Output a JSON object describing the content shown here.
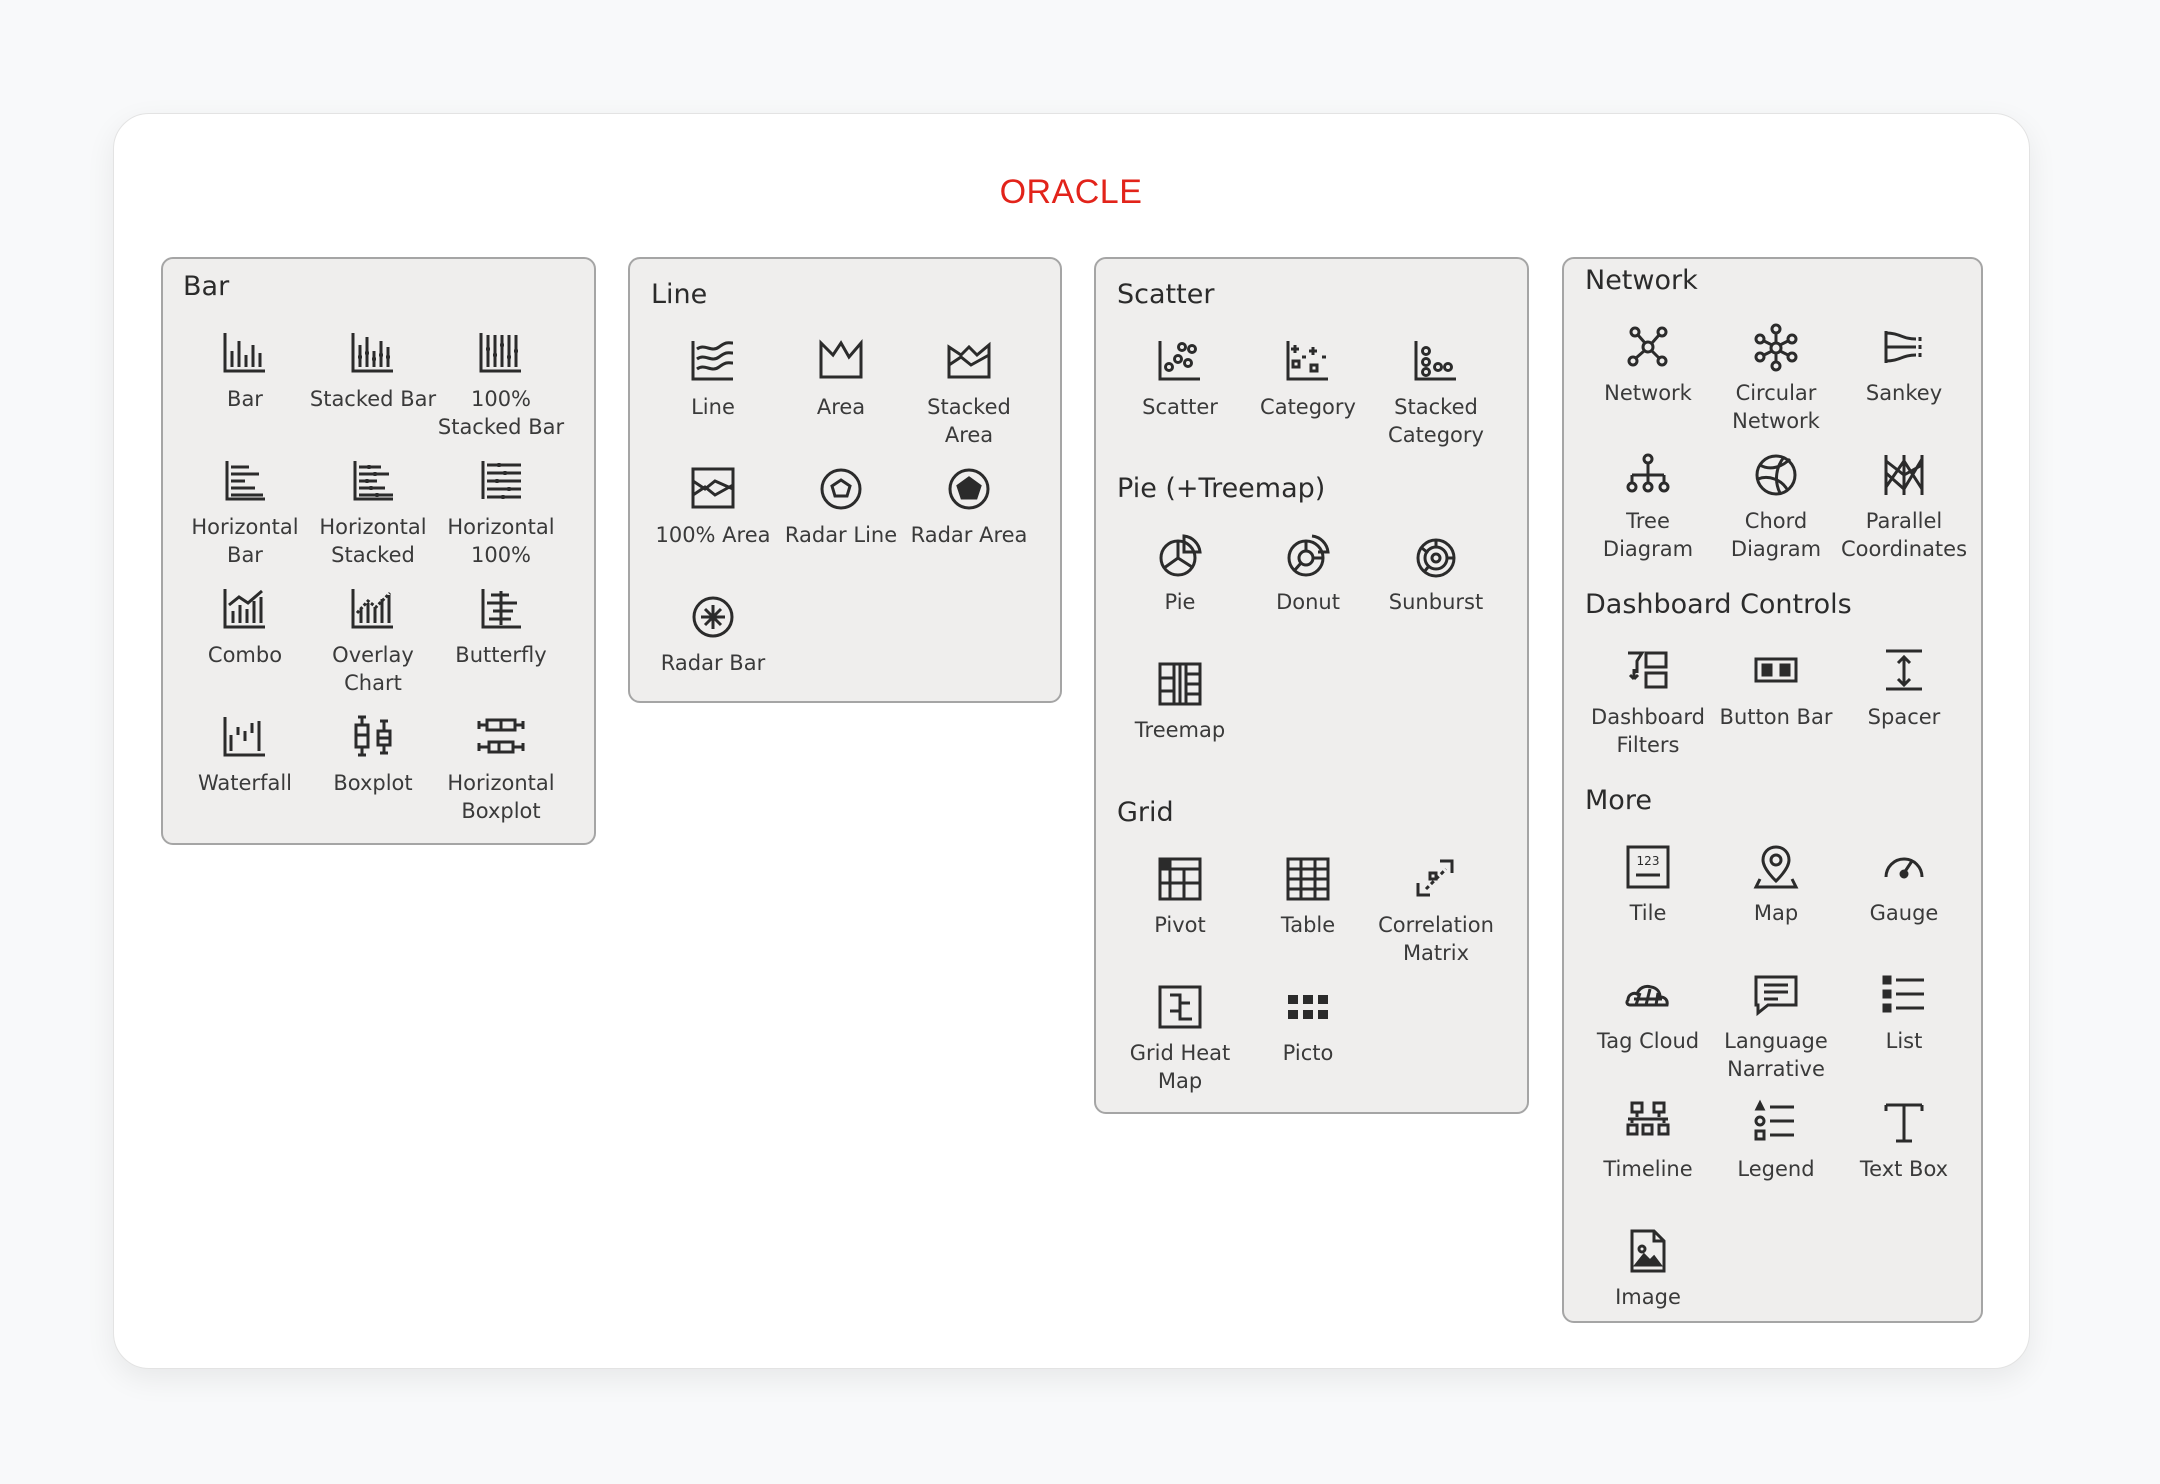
{
  "logo": {
    "text": "ORACLE",
    "color": "#e2231a"
  },
  "colors": {
    "icon": "#2b2b2b",
    "panel_bg": "#efeeed",
    "panel_border": "#a5a5a5"
  },
  "panels": {
    "bar": {
      "title": "Bar",
      "items": [
        {
          "label": "Bar",
          "icon": "bar-chart-icon"
        },
        {
          "label": "Stacked Bar",
          "icon": "stacked-bar-icon"
        },
        {
          "label": "100% Stacked Bar",
          "icon": "stacked-100-bar-icon"
        },
        {
          "label": "Horizontal Bar",
          "icon": "horizontal-bar-icon"
        },
        {
          "label": "Horizontal Stacked",
          "icon": "horizontal-stacked-icon"
        },
        {
          "label": "Horizontal 100%",
          "icon": "horizontal-100-icon"
        },
        {
          "label": "Combo",
          "icon": "combo-chart-icon"
        },
        {
          "label": "Overlay Chart",
          "icon": "overlay-chart-icon"
        },
        {
          "label": "Butterfly",
          "icon": "butterfly-chart-icon"
        },
        {
          "label": "Waterfall",
          "icon": "waterfall-chart-icon"
        },
        {
          "label": "Boxplot",
          "icon": "boxplot-icon"
        },
        {
          "label": "Horizontal Boxplot",
          "icon": "horizontal-boxplot-icon"
        }
      ]
    },
    "line": {
      "title": "Line",
      "items": [
        {
          "label": "Line",
          "icon": "line-chart-icon"
        },
        {
          "label": "Area",
          "icon": "area-chart-icon"
        },
        {
          "label": "Stacked Area",
          "icon": "stacked-area-icon"
        },
        {
          "label": "100% Area",
          "icon": "area-100-icon"
        },
        {
          "label": "Radar Line",
          "icon": "radar-line-icon"
        },
        {
          "label": "Radar Area",
          "icon": "radar-area-icon"
        },
        {
          "label": "Radar Bar",
          "icon": "radar-bar-icon"
        }
      ]
    },
    "scatter": {
      "title": "Scatter",
      "items": [
        {
          "label": "Scatter",
          "icon": "scatter-icon"
        },
        {
          "label": "Category",
          "icon": "category-scatter-icon"
        },
        {
          "label": "Stacked Category",
          "icon": "stacked-category-icon"
        }
      ]
    },
    "pie": {
      "title": "Pie (+Treemap)",
      "items": [
        {
          "label": "Pie",
          "icon": "pie-chart-icon"
        },
        {
          "label": "Donut",
          "icon": "donut-chart-icon"
        },
        {
          "label": "Sunburst",
          "icon": "sunburst-icon"
        },
        {
          "label": "Treemap",
          "icon": "treemap-icon"
        }
      ]
    },
    "grid": {
      "title": "Grid",
      "items": [
        {
          "label": "Pivot",
          "icon": "pivot-icon"
        },
        {
          "label": "Table",
          "icon": "table-icon"
        },
        {
          "label": "Correlation Matrix",
          "icon": "correlation-matrix-icon"
        },
        {
          "label": "Grid Heat Map",
          "icon": "grid-heat-map-icon"
        },
        {
          "label": "Picto",
          "icon": "picto-icon"
        }
      ]
    },
    "network": {
      "title": "Network",
      "items": [
        {
          "label": "Network",
          "icon": "network-icon"
        },
        {
          "label": "Circular Network",
          "icon": "circular-network-icon"
        },
        {
          "label": "Sankey",
          "icon": "sankey-icon"
        },
        {
          "label": "Tree Diagram",
          "icon": "tree-diagram-icon"
        },
        {
          "label": "Chord Diagram",
          "icon": "chord-diagram-icon"
        },
        {
          "label": "Parallel Coordinates",
          "icon": "parallel-coordinates-icon"
        }
      ]
    },
    "dashboard": {
      "title": "Dashboard Controls",
      "items": [
        {
          "label": "Dashboard Filters",
          "icon": "dashboard-filters-icon"
        },
        {
          "label": "Button Bar",
          "icon": "button-bar-icon"
        },
        {
          "label": "Spacer",
          "icon": "spacer-icon"
        }
      ]
    },
    "more": {
      "title": "More",
      "items": [
        {
          "label": "Tile",
          "icon": "tile-icon"
        },
        {
          "label": "Map",
          "icon": "map-pin-icon"
        },
        {
          "label": "Gauge",
          "icon": "gauge-icon"
        },
        {
          "label": "Tag Cloud",
          "icon": "tag-cloud-icon"
        },
        {
          "label": "Language Narrative",
          "icon": "language-narrative-icon"
        },
        {
          "label": "List",
          "icon": "list-icon"
        },
        {
          "label": "Timeline",
          "icon": "timeline-icon"
        },
        {
          "label": "Legend",
          "icon": "legend-icon"
        },
        {
          "label": "Text Box",
          "icon": "text-box-icon"
        },
        {
          "label": "Image",
          "icon": "image-icon"
        }
      ]
    }
  }
}
